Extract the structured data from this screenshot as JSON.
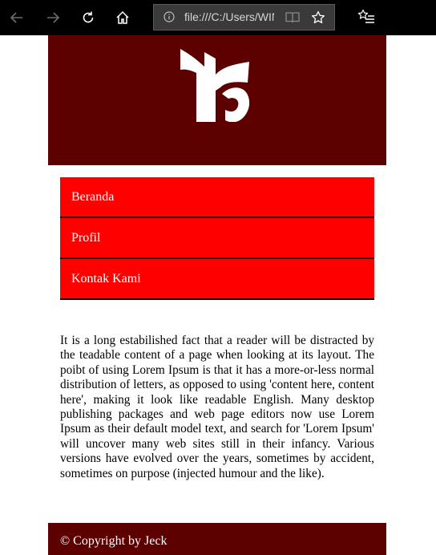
{
  "browser": {
    "address": "file:///C:/Users/WINI",
    "icons": [
      "back-arrow-icon",
      "forward-arrow-icon",
      "refresh-icon",
      "home-icon",
      "info-icon",
      "reading-view-icon",
      "favorite-star-icon",
      "favorites-hub-icon"
    ]
  },
  "header": {
    "logo_icon": "brand-logo",
    "background": "#5c0000"
  },
  "menu": {
    "items": [
      {
        "label": "Beranda"
      },
      {
        "label": "Profil"
      },
      {
        "label": "Kontak Kami"
      }
    ],
    "background": "#ff0000"
  },
  "content": {
    "paragraph": "It is a long estabilished fact that a reader will be distracted by the teadable content of a page when looking at its layout. The poibt of using Lorem Ipsum is that it has a more-or-less normal distribution of letters, as opposed to using 'content here, content here', making it look like readable English. Many desktop publishing packages and web page editors now use Lorem Ipsum as their default model text, and search for 'Lorem Ipsum' will uncover many web sites still in their infancy. Various versions have evolved over the years, sometimes by accident, sometimes on purpose (injected humour and the like)."
  },
  "footer": {
    "text": "© Copyright by Jeck"
  }
}
